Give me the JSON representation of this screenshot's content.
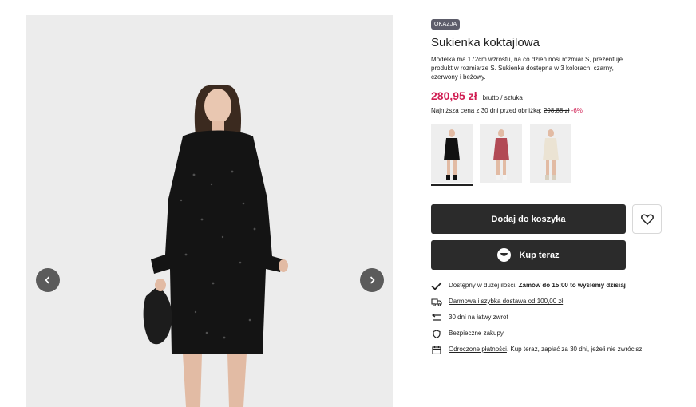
{
  "gallery": {
    "prev_icon": "chevron-left-icon",
    "next_icon": "chevron-right-icon"
  },
  "product": {
    "badge": "OKAZJA",
    "title": "Sukienka koktajlowa",
    "description": "Modelka ma 172cm wzrostu, na co dzień nosi rozmiar S, prezentuje produkt w rozmiarze S. Sukienka dostępna w 3 kolorach: czarny, czerwony i beżowy.",
    "price": "280,95 zł",
    "price_unit": "brutto / sztuka",
    "lowest_label": "Najniższa cena z 30 dni przed obniżką:",
    "lowest_price": "298,88 zł",
    "discount": "-6%",
    "colors": {
      "price_accent": "#d01d52",
      "button_dark": "#2b2b2b"
    },
    "variants": [
      {
        "name": "czarny",
        "color": "#111111",
        "active": true
      },
      {
        "name": "czerwony",
        "color": "#b24a55",
        "active": false
      },
      {
        "name": "beżowy",
        "color": "#ebe3d3",
        "active": false
      }
    ]
  },
  "actions": {
    "add_to_cart": "Dodaj do koszyka",
    "buy_now": "Kup teraz",
    "favorite_icon": "heart-icon"
  },
  "features": {
    "stock_prefix": "Dostępny w dużej ilości.",
    "stock_bold": "Zamów do 15:00 to wyślemy dzisiaj",
    "delivery": "Darmowa i szybka dostawa od 100,00 zł",
    "returns": "30 dni na łatwy zwrot",
    "secure": "Bezpieczne zakupy",
    "deferred_link": "Odroczone płatności",
    "deferred_rest": ". Kup teraz, zapłać za 30 dni, jeżeli nie zwrócisz"
  }
}
